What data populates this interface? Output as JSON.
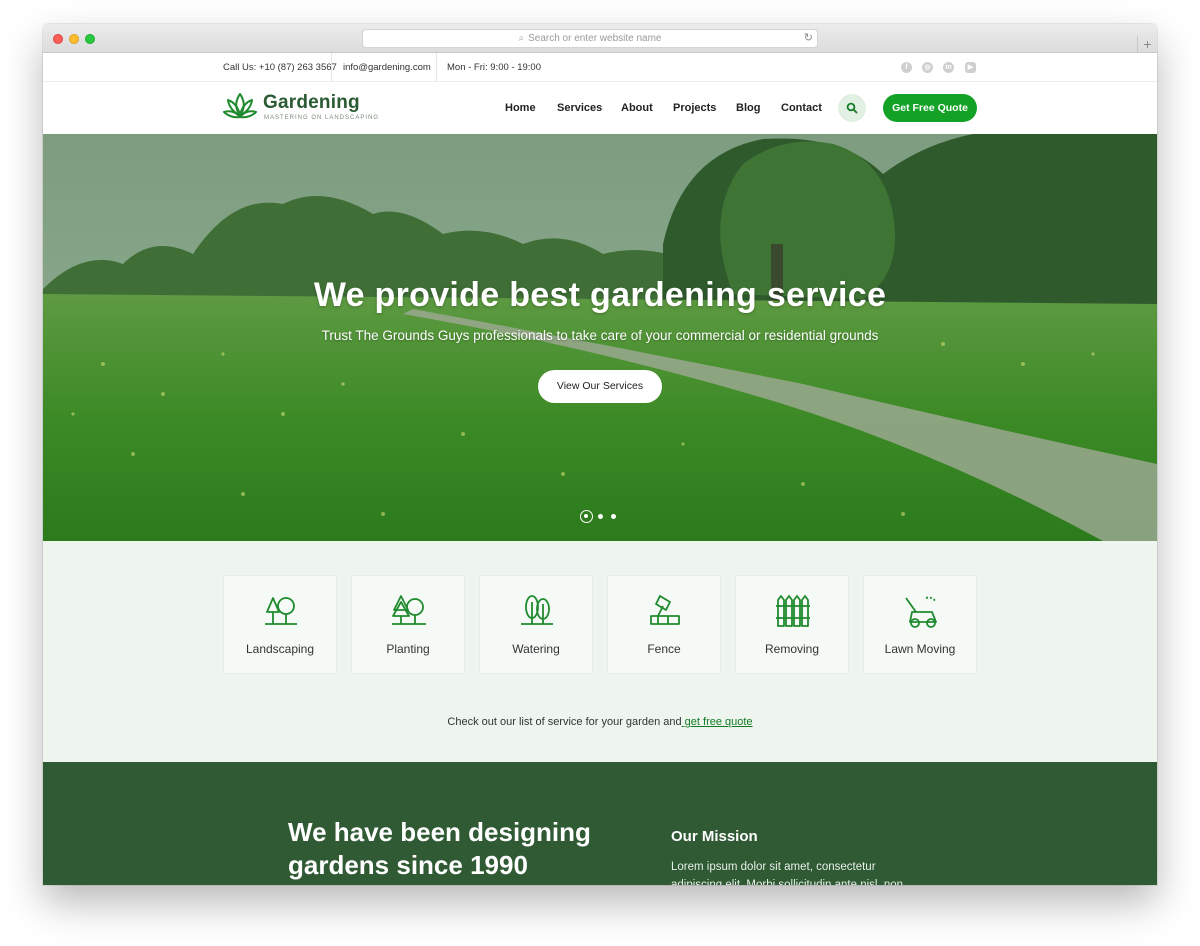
{
  "browser": {
    "url_placeholder": "Search or enter website name",
    "new_tab": "+"
  },
  "topbar": {
    "phone": "Call Us: +10 (87) 263 3567",
    "email": "info@gardening.com",
    "hours": "Mon - Fri: 9:00 - 19:00",
    "social": [
      "facebook-icon",
      "instagram-icon",
      "linkedin-icon",
      "youtube-icon"
    ]
  },
  "header": {
    "logo_title": "Gardening",
    "logo_tagline": "MASTERING ON LANDSCAPING",
    "nav": [
      "Home",
      "Services",
      "About",
      "Projects",
      "Blog",
      "Contact"
    ],
    "quote_button": "Get Free Quote"
  },
  "hero": {
    "title": "We provide best gardening service",
    "subtitle": "Trust The Grounds Guys professionals to take care of your commercial or residential grounds",
    "button": "View Our Services",
    "slides": 3,
    "active_slide": 1
  },
  "services": {
    "items": [
      {
        "label": "Landscaping",
        "icon": "landscaping-icon"
      },
      {
        "label": "Planting",
        "icon": "planting-icon"
      },
      {
        "label": "Watering",
        "icon": "watering-icon"
      },
      {
        "label": "Fence",
        "icon": "fence-tool-icon"
      },
      {
        "label": "Removing",
        "icon": "fence-icon"
      },
      {
        "label": "Lawn Moving",
        "icon": "lawn-mower-icon"
      }
    ],
    "note": "Check out our list of service for your garden and",
    "note_link": " get free quote"
  },
  "about": {
    "heading": "We have been designing gardens since 1990",
    "mission_title": "Our Mission",
    "mission_text": "Lorem ipsum dolor sit amet, consectetur adipiscing elit. Morbi sollicitudin ante nisl, non"
  },
  "colors": {
    "brand_green": "#14a226",
    "dark_green": "#2f5a34",
    "accent_text": "#137a24"
  }
}
